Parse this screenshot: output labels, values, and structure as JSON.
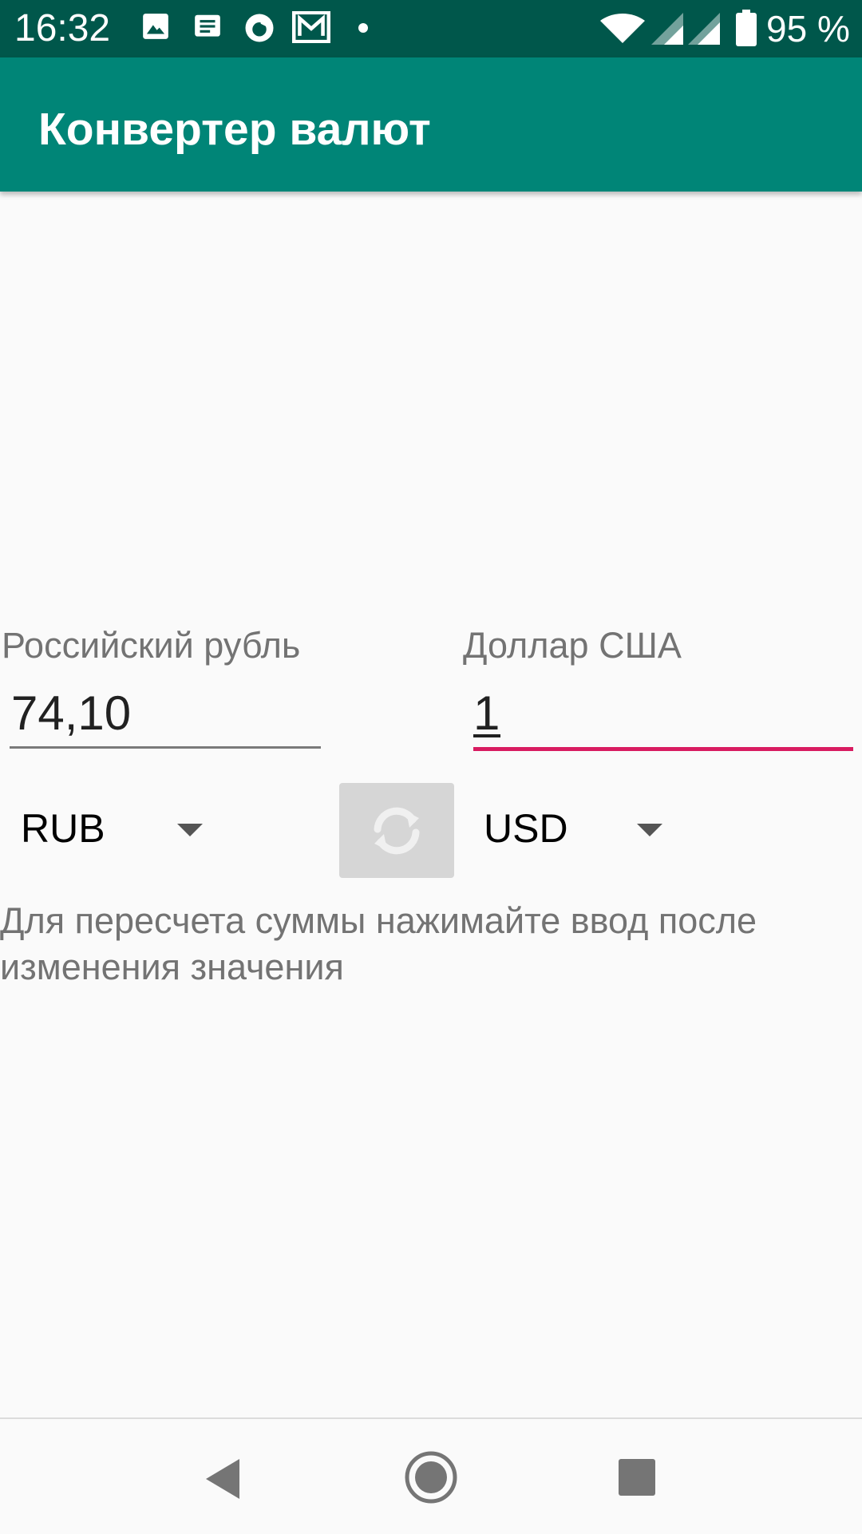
{
  "status_bar": {
    "time": "16:32",
    "battery": "95 %",
    "icons": [
      "image-icon",
      "message-icon",
      "firefox-icon",
      "mail-icon",
      "dot-icon",
      "wifi-icon",
      "signal-icon",
      "signal-icon",
      "battery-icon"
    ]
  },
  "app_bar": {
    "title": "Конвертер валют",
    "color": "#008577"
  },
  "converter": {
    "from_label": "Российский рубль",
    "from_value": "74,10",
    "to_label": "Доллар США",
    "to_value": "1",
    "from_currency": "RUB",
    "to_currency": "USD",
    "swap_icon": "refresh-icon",
    "hint": "Для пересчета суммы нажимайте ввод после изменения значения",
    "accent_color": "#d81b60"
  },
  "nav_bar": {
    "buttons": [
      "back-icon",
      "home-icon",
      "recents-icon"
    ]
  }
}
